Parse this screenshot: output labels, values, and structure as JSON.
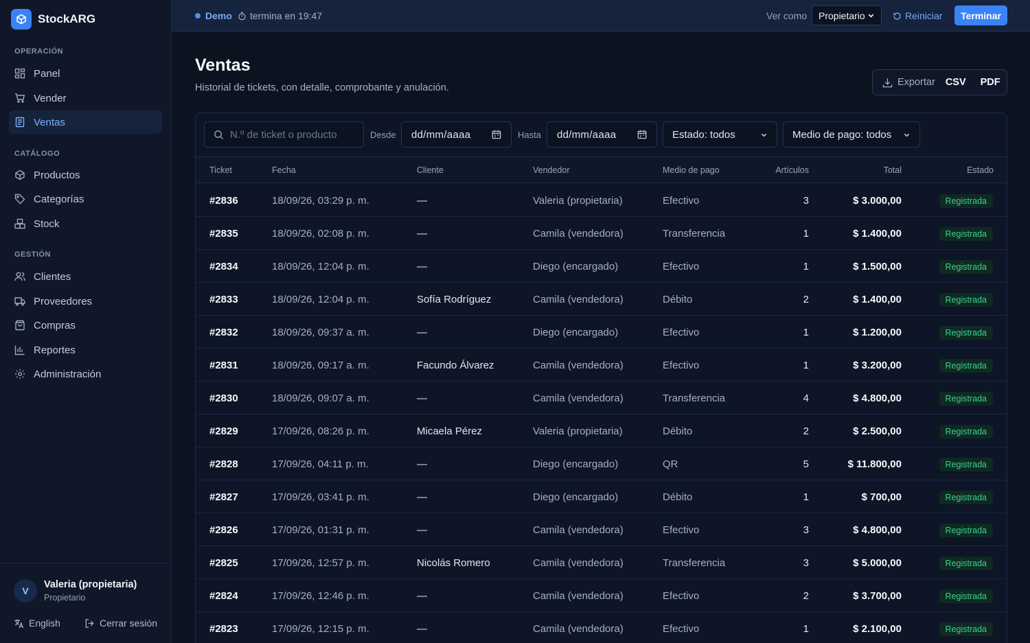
{
  "brand": {
    "name": "StockARG"
  },
  "sidebar": {
    "sections": [
      {
        "label": "OPERACIÓN",
        "items": [
          {
            "label": "Panel",
            "icon": "dashboard-icon"
          },
          {
            "label": "Vender",
            "icon": "cart-icon"
          },
          {
            "label": "Ventas",
            "icon": "receipt-icon",
            "active": true
          }
        ]
      },
      {
        "label": "CATÁLOGO",
        "items": [
          {
            "label": "Productos",
            "icon": "box-icon"
          },
          {
            "label": "Categorías",
            "icon": "tag-icon"
          },
          {
            "label": "Stock",
            "icon": "boxes-icon"
          }
        ]
      },
      {
        "label": "GESTIÓN",
        "items": [
          {
            "label": "Clientes",
            "icon": "users-icon"
          },
          {
            "label": "Proveedores",
            "icon": "truck-icon"
          },
          {
            "label": "Compras",
            "icon": "shopping-bag-icon"
          },
          {
            "label": "Reportes",
            "icon": "bar-chart-icon"
          },
          {
            "label": "Administración",
            "icon": "gear-icon"
          }
        ]
      }
    ],
    "user": {
      "initial": "V",
      "name": "Valeria (propietaria)",
      "role": "Propietario"
    },
    "language": "English",
    "logout": "Cerrar sesión"
  },
  "topbar": {
    "demo": "Demo",
    "timer": "termina en 19:47",
    "view_as_label": "Ver como",
    "view_as_value": "Propietario",
    "reset": "Reiniciar",
    "finish": "Terminar"
  },
  "page": {
    "title": "Ventas",
    "subtitle": "Historial de tickets, con detalle, comprobante y anulación.",
    "export_label": "Exportar",
    "export_csv": "CSV",
    "export_pdf": "PDF"
  },
  "filters": {
    "search_placeholder": "N.º de ticket o producto",
    "from_label": "Desde",
    "from_value": "dd/mm/aaaa",
    "to_label": "Hasta",
    "to_value": "dd/mm/aaaa",
    "status": "Estado: todos",
    "payment": "Medio de pago: todos"
  },
  "table": {
    "headers": [
      "Ticket",
      "Fecha",
      "Cliente",
      "Vendedor",
      "Medio de pago",
      "Artículos",
      "Total",
      "Estado"
    ],
    "rows": [
      [
        "#2836",
        "18/09/26, 03:29 p. m.",
        "—",
        "Valeria (propietaria)",
        "Efectivo",
        "3",
        "$ 3.000,00",
        "Registrada"
      ],
      [
        "#2835",
        "18/09/26, 02:08 p. m.",
        "—",
        "Camila (vendedora)",
        "Transferencia",
        "1",
        "$ 1.400,00",
        "Registrada"
      ],
      [
        "#2834",
        "18/09/26, 12:04 p. m.",
        "—",
        "Diego (encargado)",
        "Efectivo",
        "1",
        "$ 1.500,00",
        "Registrada"
      ],
      [
        "#2833",
        "18/09/26, 12:04 p. m.",
        "Sofía Rodríguez",
        "Camila (vendedora)",
        "Débito",
        "2",
        "$ 1.400,00",
        "Registrada"
      ],
      [
        "#2832",
        "18/09/26, 09:37 a. m.",
        "—",
        "Diego (encargado)",
        "Efectivo",
        "1",
        "$ 1.200,00",
        "Registrada"
      ],
      [
        "#2831",
        "18/09/26, 09:17 a. m.",
        "Facundo Álvarez",
        "Camila (vendedora)",
        "Efectivo",
        "1",
        "$ 3.200,00",
        "Registrada"
      ],
      [
        "#2830",
        "18/09/26, 09:07 a. m.",
        "—",
        "Camila (vendedora)",
        "Transferencia",
        "4",
        "$ 4.800,00",
        "Registrada"
      ],
      [
        "#2829",
        "17/09/26, 08:26 p. m.",
        "Micaela Pérez",
        "Valeria (propietaria)",
        "Débito",
        "2",
        "$ 2.500,00",
        "Registrada"
      ],
      [
        "#2828",
        "17/09/26, 04:11 p. m.",
        "—",
        "Diego (encargado)",
        "QR",
        "5",
        "$ 11.800,00",
        "Registrada"
      ],
      [
        "#2827",
        "17/09/26, 03:41 p. m.",
        "—",
        "Diego (encargado)",
        "Débito",
        "1",
        "$ 700,00",
        "Registrada"
      ],
      [
        "#2826",
        "17/09/26, 01:31 p. m.",
        "—",
        "Camila (vendedora)",
        "Efectivo",
        "3",
        "$ 4.800,00",
        "Registrada"
      ],
      [
        "#2825",
        "17/09/26, 12:57 p. m.",
        "Nicolás Romero",
        "Camila (vendedora)",
        "Transferencia",
        "3",
        "$ 5.000,00",
        "Registrada"
      ],
      [
        "#2824",
        "17/09/26, 12:46 p. m.",
        "—",
        "Camila (vendedora)",
        "Efectivo",
        "2",
        "$ 3.700,00",
        "Registrada"
      ],
      [
        "#2823",
        "17/09/26, 12:15 p. m.",
        "—",
        "Camila (vendedora)",
        "Efectivo",
        "1",
        "$ 2.100,00",
        "Registrada"
      ]
    ]
  },
  "colors": {
    "accent": "#3b82f6",
    "success": "#3fcf8e",
    "background": "#0b1220"
  }
}
